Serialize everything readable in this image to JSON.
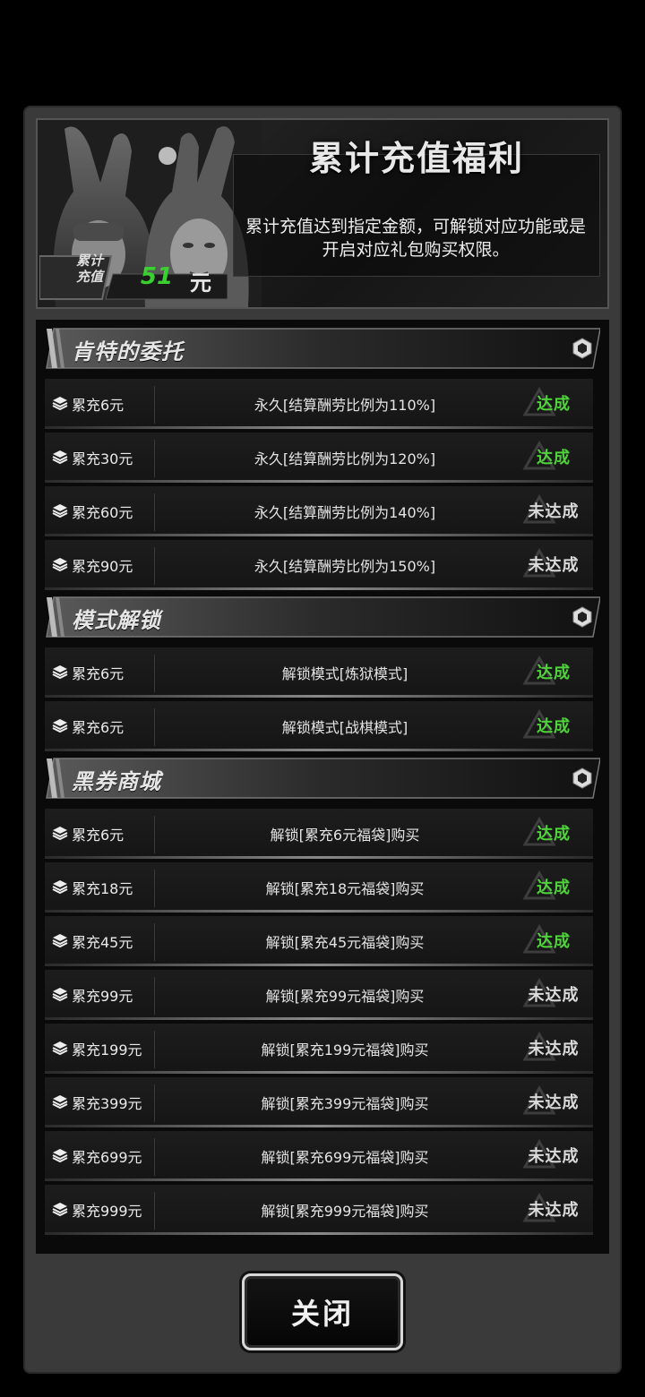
{
  "header": {
    "title": "累计充值福利",
    "description_line1": "累计充值达到指定金额，可解锁对应功能或是",
    "description_line2": "开启对应礼包购买权限。",
    "total_label_line1": "累计",
    "total_label_line2": "充值",
    "total_value": "51",
    "total_unit": "元"
  },
  "sections": [
    {
      "title": "肯特的委托",
      "rows": [
        {
          "amount": "累充6元",
          "reward": "永久[结算酬劳比例为110%]",
          "status": "达成",
          "done": true
        },
        {
          "amount": "累充30元",
          "reward": "永久[结算酬劳比例为120%]",
          "status": "达成",
          "done": true
        },
        {
          "amount": "累充60元",
          "reward": "永久[结算酬劳比例为140%]",
          "status": "未达成",
          "done": false
        },
        {
          "amount": "累充90元",
          "reward": "永久[结算酬劳比例为150%]",
          "status": "未达成",
          "done": false
        }
      ]
    },
    {
      "title": "模式解锁",
      "rows": [
        {
          "amount": "累充6元",
          "reward": "解锁模式[炼狱模式]",
          "status": "达成",
          "done": true
        },
        {
          "amount": "累充6元",
          "reward": "解锁模式[战棋模式]",
          "status": "达成",
          "done": true
        }
      ]
    },
    {
      "title": "黑券商城",
      "rows": [
        {
          "amount": "累充6元",
          "reward": "解锁[累充6元福袋]购买",
          "status": "达成",
          "done": true
        },
        {
          "amount": "累充18元",
          "reward": "解锁[累充18元福袋]购买",
          "status": "达成",
          "done": true
        },
        {
          "amount": "累充45元",
          "reward": "解锁[累充45元福袋]购买",
          "status": "达成",
          "done": true
        },
        {
          "amount": "累充99元",
          "reward": "解锁[累充99元福袋]购买",
          "status": "未达成",
          "done": false
        },
        {
          "amount": "累充199元",
          "reward": "解锁[累充199元福袋]购买",
          "status": "未达成",
          "done": false
        },
        {
          "amount": "累充399元",
          "reward": "解锁[累充399元福袋]购买",
          "status": "未达成",
          "done": false
        },
        {
          "amount": "累充699元",
          "reward": "解锁[累充699元福袋]购买",
          "status": "未达成",
          "done": false
        },
        {
          "amount": "累充999元",
          "reward": "解锁[累充999元福袋]购买",
          "status": "未达成",
          "done": false
        }
      ]
    }
  ],
  "close_label": "关闭",
  "colors": {
    "done": "#4fd23a",
    "undone": "#d9d9d9",
    "total_value": "#39d12f"
  }
}
